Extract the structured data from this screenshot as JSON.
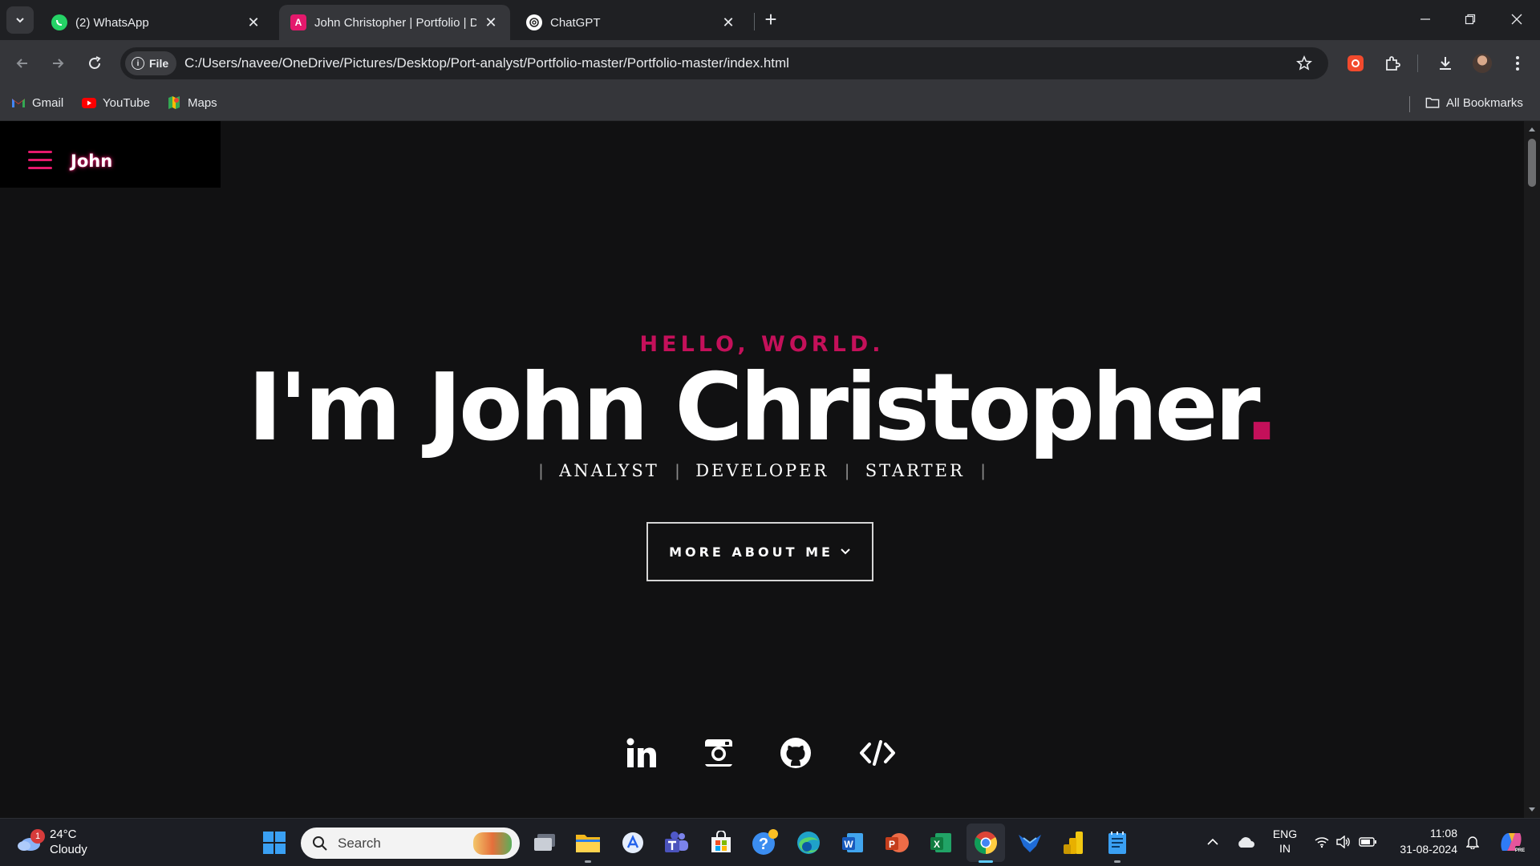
{
  "browser": {
    "tabs": [
      {
        "title": "(2) WhatsApp",
        "favicon": "whatsapp-icon",
        "active": false
      },
      {
        "title": "John Christopher | Portfolio | Developer",
        "favicon": "portfolio-icon",
        "active": true
      },
      {
        "title": "ChatGPT",
        "favicon": "chatgpt-icon",
        "active": false
      }
    ],
    "address": {
      "chip_label": "File",
      "url": "C:/Users/navee/OneDrive/Pictures/Desktop/Port-analyst/Portfolio-master/Portfolio-master/index.html"
    },
    "bookmarks": [
      {
        "label": "Gmail",
        "icon": "gmail-icon"
      },
      {
        "label": "YouTube",
        "icon": "youtube-icon"
      },
      {
        "label": "Maps",
        "icon": "maps-icon"
      }
    ],
    "all_bookmarks_label": "All Bookmarks"
  },
  "page": {
    "brand": "John",
    "hello": "HELLO, WORLD.",
    "headline": "I'm John Christopher",
    "headline_dot": ".",
    "roles": [
      "ANALYST",
      "DEVELOPER",
      "STARTER"
    ],
    "role_separator": "|",
    "more_button": "MORE ABOUT ME",
    "socials": [
      "linkedin-icon",
      "instagram-icon",
      "github-icon",
      "code-icon"
    ],
    "accent_color": "#c4105a"
  },
  "taskbar": {
    "weather_temp": "24°C",
    "weather_desc": "Cloudy",
    "weather_badge": "1",
    "search_placeholder": "Search",
    "lang_top": "ENG",
    "lang_bottom": "IN",
    "time": "11:08",
    "date": "31-08-2024"
  }
}
